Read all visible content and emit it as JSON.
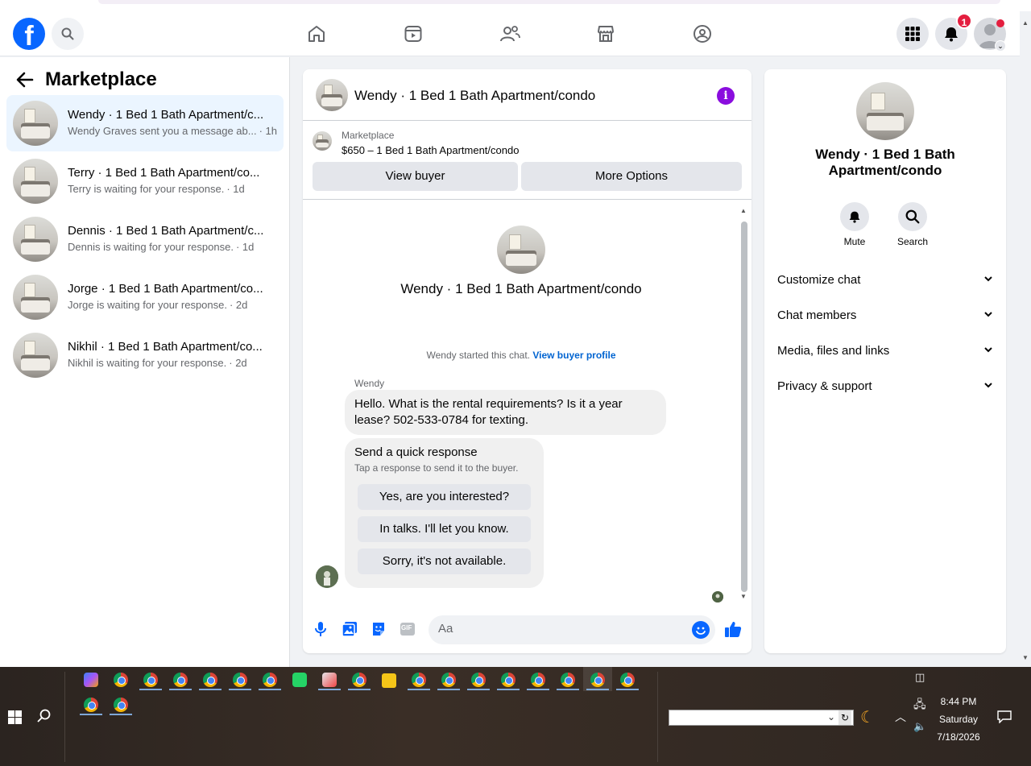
{
  "topnav": {
    "logo": "f",
    "notifications_badge": "1"
  },
  "sidebar": {
    "title": "Marketplace",
    "threads": [
      {
        "name": "Wendy · 1 Bed 1 Bath Apartment/c...",
        "preview": "Wendy Graves sent you a message ab...",
        "time": "· 1h",
        "active": true
      },
      {
        "name": "Terry · 1 Bed 1 Bath Apartment/co...",
        "preview": "Terry is waiting for your response.",
        "time": "· 1d",
        "active": false
      },
      {
        "name": "Dennis · 1 Bed 1 Bath Apartment/c...",
        "preview": "Dennis is waiting for your response.",
        "time": "· 1d",
        "active": false
      },
      {
        "name": "Jorge · 1 Bed 1 Bath Apartment/co...",
        "preview": "Jorge is waiting for your response.",
        "time": "· 2d",
        "active": false
      },
      {
        "name": "Nikhil · 1 Bed 1 Bath Apartment/co...",
        "preview": "Nikhil is waiting for your response.",
        "time": "· 2d",
        "active": false
      }
    ]
  },
  "chat": {
    "title": "Wendy · 1 Bed 1 Bath Apartment/condo",
    "marketplace_label": "Marketplace",
    "listing": "$650 – 1 Bed 1 Bath Apartment/condo",
    "view_buyer": "View buyer",
    "more_options": "More Options",
    "conversation_title": "Wendy · 1 Bed 1 Bath Apartment/condo",
    "started_text": "Wendy started this chat.",
    "view_buyer_profile": "View buyer profile",
    "sender": "Wendy",
    "message": "Hello. What is the rental requirements? Is it a year lease? 502-533-0784 for texting.",
    "quick_title": "Send a quick response",
    "quick_subtitle": "Tap a response to send it to the buyer.",
    "quick_responses": [
      "Yes, are you interested?",
      "In talks. I'll let you know.",
      "Sorry, it's not available."
    ],
    "composer_placeholder": "Aa",
    "gif_label": "GIF"
  },
  "info_panel": {
    "title": "Wendy · 1 Bed 1 Bath Apartment/condo",
    "mute": "Mute",
    "search": "Search",
    "sections": [
      "Customize chat",
      "Chat members",
      "Media, files and links",
      "Privacy & support"
    ]
  },
  "taskbar": {
    "time": "8:44 PM",
    "day": "Saturday",
    "date": "7/18/2026"
  },
  "colors": {
    "brand": "#0866ff",
    "info_accent": "#8a0dde",
    "badge": "#e41e3f"
  }
}
